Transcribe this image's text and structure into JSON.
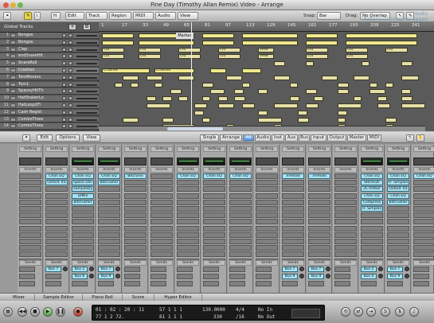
{
  "window": {
    "title": "Fine Day (Timothy Allan Remix) Video - Arrange"
  },
  "watermark": {
    "line1": "Hooks",
    "line2": "Работа с группами видео"
  },
  "toolbar": {
    "h_label": "H",
    "edit": "Edit",
    "track": "Track",
    "region": "Region",
    "midi": "MIDI",
    "audio": "Audio",
    "view": "View",
    "snap_label": "Snap:",
    "snap_value": "Bar",
    "drag_label": "Drag:",
    "drag_value": "No Overlap"
  },
  "tracks": {
    "global": "Global Tracks",
    "rows": [
      {
        "num": "1",
        "name": "Bongos"
      },
      {
        "num": "2",
        "name": "Bongos"
      },
      {
        "num": "3",
        "name": "Clap"
      },
      {
        "num": "4",
        "name": "endSnareHit"
      },
      {
        "num": "5",
        "name": "SnareRoll"
      },
      {
        "num": "6",
        "name": "Crashes"
      },
      {
        "num": "7",
        "name": "TomMovers"
      },
      {
        "num": "8",
        "name": "Tom1"
      },
      {
        "num": "9",
        "name": "SpaceyHitTh"
      },
      {
        "num": "10",
        "name": "HatShakerLo"
      },
      {
        "num": "11",
        "name": "HatLoop2Fi"
      },
      {
        "num": "12",
        "name": "Cash Regist"
      },
      {
        "num": "13",
        "name": "ComboThwa"
      },
      {
        "num": "14",
        "name": "ComboThwa"
      }
    ]
  },
  "ruler": [
    "1",
    "17",
    "33",
    "49",
    "65",
    "81",
    "97",
    "113",
    "129",
    "145",
    "161",
    "177",
    "193",
    "209",
    "225",
    "241"
  ],
  "marker": "Marker",
  "regions": {
    "clu": "Clu",
    "crash": "Crashes",
    "view": "View"
  },
  "mixer": {
    "edit": "Edit",
    "options": "Options",
    "view": "View",
    "tabs": [
      "Single",
      "Arrange",
      "All",
      "Audio",
      "Inst",
      "Aux",
      "Bus",
      "Input",
      "Output",
      "Master",
      "MIDI"
    ],
    "setting": "Setting",
    "eq": "EQ",
    "inserts": "Inserts",
    "sends": "Sends",
    "plugins": {
      "s1": [
        "Chan EQ",
        "Oxford Tra"
      ],
      "s2": [
        "Chan EQ",
        "Space Dsn",
        "SampleDly",
        "DiMix",
        "Bitcrusher"
      ],
      "s3": [
        "Chan EQ",
        "Bitcrusher"
      ],
      "s4": [
        "Bitcrusiv"
      ],
      "s5": [
        "Chan EQ"
      ],
      "s6": [
        "Chan EQ"
      ],
      "s7": [
        "Chan EQ"
      ],
      "s8": [
        "Tremolo"
      ],
      "s9": [
        "Tremolo"
      ],
      "s10": [
        "Chan EQ",
        "Stereoizr",
        "2C-Arther",
        "Chan EQ",
        "Compress",
        "FF Simplon"
      ],
      "s11": [
        "Chan EQ",
        "FF Simplon",
        "Oxford Tra",
        "Chan EQ",
        "Bitcrusher"
      ],
      "s12": [
        "Chan EQ"
      ]
    },
    "buses": {
      "s1": [
        "Bus 7"
      ],
      "s2": [
        "Bus 2",
        "Bus 6"
      ],
      "s3": [
        "Bus 7",
        "Bus 9"
      ],
      "s8": [
        "Bus 7",
        "Bus 9"
      ],
      "s9": [
        "Bus 7",
        "Bus 9"
      ],
      "s10": [
        "Bus 2",
        "Bus 4"
      ],
      "s11": [
        "Bus 7",
        "Bus 9"
      ]
    }
  },
  "status_tabs": [
    "Mixer",
    "Sample Editor",
    "Piano Roll",
    "Score",
    "Hyper Editor"
  ],
  "transport": {
    "smpte": "01 : 02 : 20 : 11",
    "bars": "77   1   2   72.",
    "pos2": "57   1   1   1",
    "pos3": "81   1   1   1",
    "tempo": "130.0000",
    "division": "330",
    "sig_top": "4/4",
    "sig_bottom": "/16",
    "in": "No In",
    "out": "No Out"
  }
}
